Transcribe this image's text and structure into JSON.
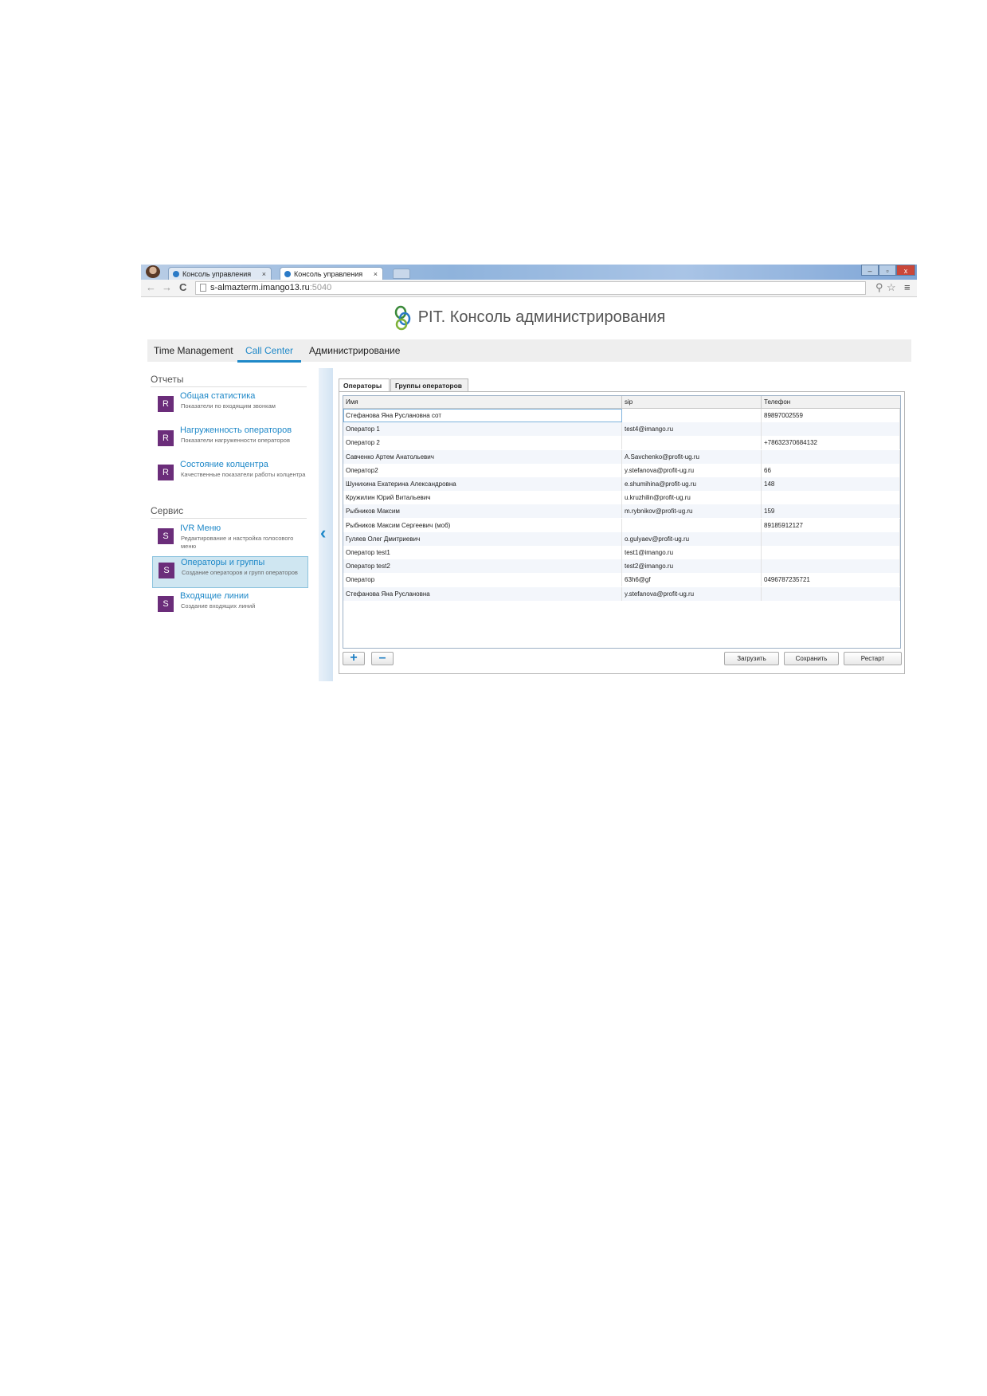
{
  "browser": {
    "tabs": [
      {
        "label": "Консоль управления",
        "close": "×"
      },
      {
        "label": "Консоль управления",
        "close": "×"
      }
    ],
    "url_host": "s-almazterm.imango13.ru",
    "url_port": ":5040",
    "nav": {
      "back": "←",
      "forward": "→",
      "reload": "C"
    },
    "window_controls": {
      "minimize": "–",
      "maximize": "▫",
      "close": "x"
    },
    "toolbar_icons": {
      "key": "⚲",
      "star": "☆",
      "menu": "≡"
    }
  },
  "app": {
    "title": "PIT. Консоль администрирования"
  },
  "menubar": {
    "items": [
      "Time Management",
      "Call Center",
      "Администрирование"
    ],
    "active_index": 1
  },
  "sidebar": {
    "reports_title": "Отчеты",
    "reports": [
      {
        "badge": "R",
        "title": "Общая статистика",
        "desc": "Показатели по входящим звонкам"
      },
      {
        "badge": "R",
        "title": "Нагруженность операторов",
        "desc": "Показатели нагруженности операторов"
      },
      {
        "badge": "R",
        "title": "Состояние колцентра",
        "desc": "Качественные показатели работы колцентра"
      }
    ],
    "service_title": "Сервис",
    "service": [
      {
        "badge": "S",
        "title": "IVR Меню",
        "desc": "Редактирование и настройка голосового меню"
      },
      {
        "badge": "S",
        "title": "Операторы и группы",
        "desc": "Создание операторов и групп операторов"
      },
      {
        "badge": "S",
        "title": "Входящие линии",
        "desc": "Создание входящих линий"
      }
    ],
    "selected": "Операторы и группы"
  },
  "collapse_arrow": "‹",
  "panel": {
    "tabs": [
      "Операторы",
      "Группы операторов"
    ],
    "active_tab": 0,
    "columns": [
      "Имя",
      "sip",
      "Телефон"
    ],
    "rows": [
      {
        "name": "Стефанова Яна Руслановна сот",
        "sip": "",
        "phone": "89897002559"
      },
      {
        "name": "Оператор 1",
        "sip": "test4@imango.ru",
        "phone": ""
      },
      {
        "name": "Оператор 2",
        "sip": "",
        "phone": "+78632370684132"
      },
      {
        "name": "Савченко Артем Анатольевич",
        "sip": "A.Savchenko@profit-ug.ru",
        "phone": ""
      },
      {
        "name": "Оператор2",
        "sip": "y.stefanova@profit-ug.ru",
        "phone": "66"
      },
      {
        "name": "Шунихина Екатерина Александровна",
        "sip": "e.shumihina@profit-ug.ru",
        "phone": "148"
      },
      {
        "name": "Кружилин Юрий Витальевич",
        "sip": "u.kruzhilin@profit-ug.ru",
        "phone": ""
      },
      {
        "name": "Рыбников Максим",
        "sip": "m.rybnikov@profit-ug.ru",
        "phone": "159"
      },
      {
        "name": "Рыбников Максим Сергеевич (моб)",
        "sip": "",
        "phone": "89185912127"
      },
      {
        "name": "Гуляев Олег Дмитриевич",
        "sip": "o.gulyaev@profit-ug.ru",
        "phone": ""
      },
      {
        "name": "Оператор test1",
        "sip": "test1@imango.ru",
        "phone": ""
      },
      {
        "name": "Оператор test2",
        "sip": "test2@imango.ru",
        "phone": ""
      },
      {
        "name": "Оператор",
        "sip": "63h6@gf",
        "phone": "0496787235721"
      },
      {
        "name": "Стефанова Яна Руслановна",
        "sip": "y.stefanova@profit-ug.ru",
        "phone": ""
      }
    ],
    "buttons": {
      "add": "+",
      "remove": "–",
      "load": "Загрузить",
      "save": "Сохранить",
      "restart": "Рестарт"
    }
  },
  "colors": {
    "accent": "#1e88c8",
    "badge": "#6b2d7a",
    "selected_bg": "#cfe6f1"
  }
}
